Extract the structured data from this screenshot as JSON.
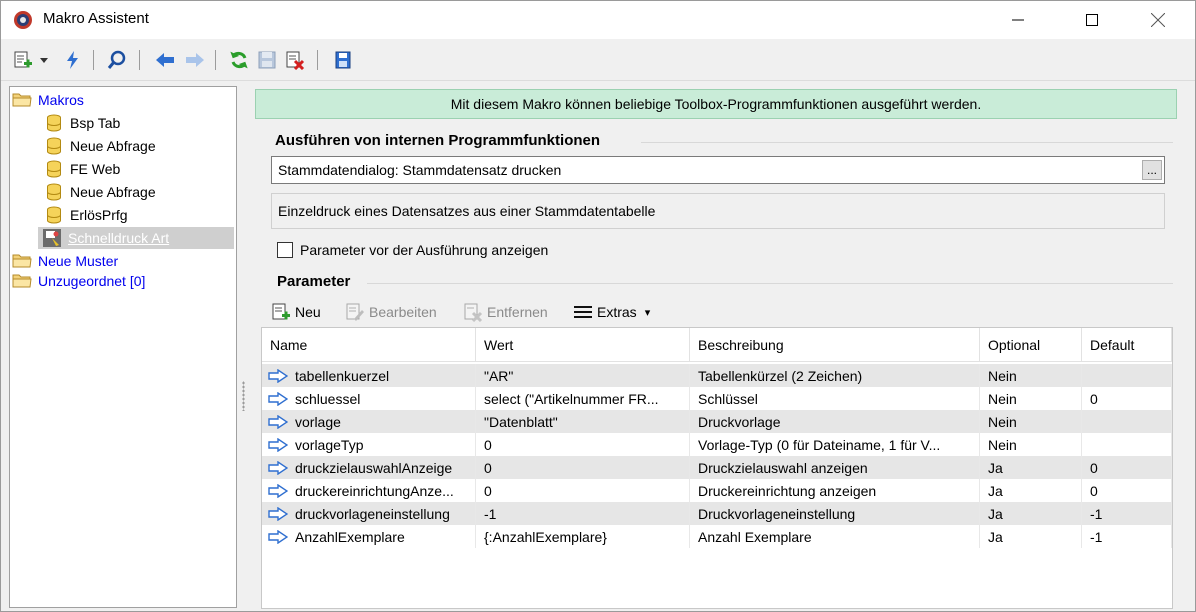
{
  "window": {
    "title": "Makro Assistent"
  },
  "toolbar": {
    "items": [
      {
        "icon": "new-document-icon"
      },
      {
        "icon": "dropdown-arrow-icon"
      },
      {
        "icon": "lightning-icon"
      },
      {
        "icon": "search-icon"
      },
      {
        "icon": "arrow-left-icon"
      },
      {
        "icon": "arrow-right-icon"
      },
      {
        "icon": "refresh-icon"
      },
      {
        "icon": "save-icon"
      },
      {
        "icon": "delete-icon"
      },
      {
        "icon": "save-close-icon"
      }
    ]
  },
  "tree": {
    "root": "Makros",
    "children": [
      "Bsp Tab",
      "Neue Abfrage",
      "FE Web",
      "Neue Abfrage",
      "ErlösPrfg",
      "Schnelldruck Art"
    ],
    "selected_index": 5,
    "siblings": [
      "Neue Muster",
      "Unzugeordnet [0]"
    ]
  },
  "banner": "Mit diesem Makro können beliebige Toolbox-Programmfunktionen ausgeführt werden.",
  "exec_group": {
    "title": "Ausführen von internen Programmfunktionen",
    "function": "Stammdatendialog: Stammdatensatz drucken",
    "ellipsis": "...",
    "description": "Einzeldruck eines Datensatzes aus einer Stammdatentabelle",
    "checkbox_label": "Parameter vor der Ausführung anzeigen",
    "checkbox_checked": false
  },
  "param_group": {
    "title": "Parameter",
    "toolbar": {
      "new": "Neu",
      "edit": "Bearbeiten",
      "remove": "Entfernen",
      "extras": "Extras",
      "extras_arrow": "▾"
    },
    "columns": [
      "Name",
      "Wert",
      "Beschreibung",
      "Optional",
      "Default"
    ],
    "rows": [
      {
        "name": "tabellenkuerzel",
        "wert": "\"AR\"",
        "beschreibung": "Tabellenkürzel (2 Zeichen)",
        "optional": "Nein",
        "default": ""
      },
      {
        "name": "schluessel",
        "wert": "select (\"Artikelnummer FR...",
        "beschreibung": "Schlüssel",
        "optional": "Nein",
        "default": "0"
      },
      {
        "name": "vorlage",
        "wert": "\"Datenblatt\"",
        "beschreibung": "Druckvorlage",
        "optional": "Nein",
        "default": ""
      },
      {
        "name": "vorlageTyp",
        "wert": "0",
        "beschreibung": "Vorlage-Typ (0 für Dateiname, 1 für V...",
        "optional": "Nein",
        "default": ""
      },
      {
        "name": "druckzielauswahlAnzeige",
        "wert": "0",
        "beschreibung": "Druckzielauswahl anzeigen",
        "optional": "Ja",
        "default": "0"
      },
      {
        "name": "druckereinrichtungAnze...",
        "wert": "0",
        "beschreibung": "Druckereinrichtung anzeigen",
        "optional": "Ja",
        "default": "0"
      },
      {
        "name": "druckvorlageneinstellung",
        "wert": "-1",
        "beschreibung": "Druckvorlageneinstellung",
        "optional": "Ja",
        "default": "-1"
      },
      {
        "name": "AnzahlExemplare",
        "wert": "{:AnzahlExemplare}",
        "beschreibung": "Anzahl Exemplare",
        "optional": "Ja",
        "default": "-1"
      }
    ]
  },
  "colors": {
    "banner_bg": "#c9ecd8",
    "link": "#0000ee",
    "row_alt": "#e6e6e6"
  }
}
